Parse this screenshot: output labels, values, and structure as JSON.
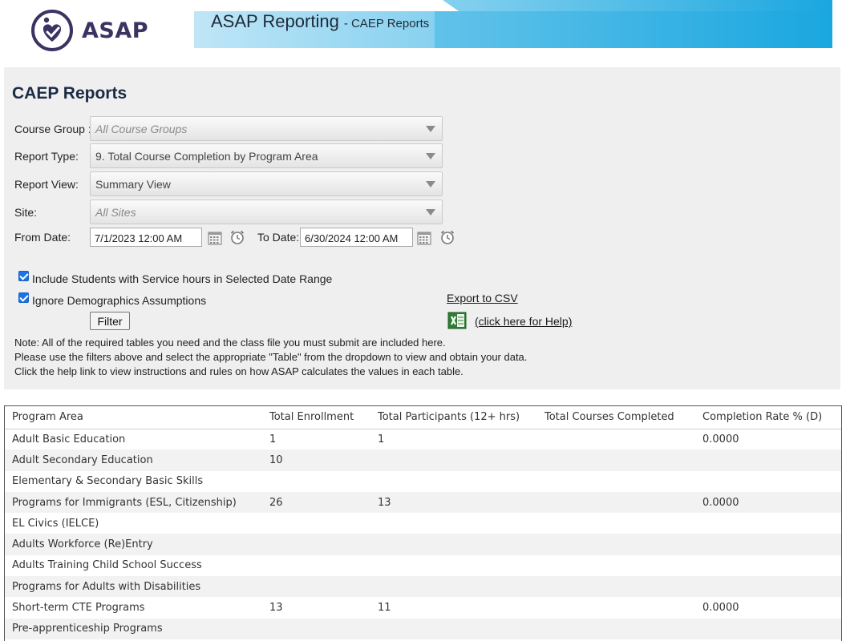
{
  "header": {
    "logo_text": "ASAP",
    "banner_title": "ASAP Reporting",
    "banner_subtitle": "- CAEP Reports",
    "colors": {
      "banner": "#1aa7df",
      "logo": "#3a3463"
    }
  },
  "filters": {
    "title": "CAEP Reports",
    "course_group": {
      "label": "Course Group :",
      "value": "All Course Groups"
    },
    "report_type": {
      "label": "Report Type:",
      "value": "9. Total Course Completion by Program Area"
    },
    "report_view": {
      "label": "Report View:",
      "value": "Summary View"
    },
    "site": {
      "label": "Site:",
      "value": "All Sites"
    },
    "from_date": {
      "label": "From Date:",
      "value": "7/1/2023 12:00 AM"
    },
    "to_date": {
      "label": "To Date:",
      "value": "6/30/2024 12:00 AM"
    },
    "include_service_hours": {
      "label": "Include Students with Service hours in Selected Date Range",
      "checked": true
    },
    "ignore_demographics": {
      "label": "Ignore Demographics Assumptions",
      "checked": true
    },
    "filter_button": "Filter",
    "export_link": "Export to CSV",
    "help_link": "(click here for Help)",
    "note_lines": [
      "Note: All of the required tables you need and the class file you must submit are included here.",
      "Please use the filters above and select the appropriate \"Table\" from the dropdown to view and obtain your data.",
      "Click the help link to view instructions and rules on how ASAP calculates the values in each table."
    ]
  },
  "table": {
    "headers": [
      "Program Area",
      "Total Enrollment",
      "Total Participants (12+ hrs)",
      "Total Courses Completed",
      "Completion Rate % (D)"
    ],
    "rows": [
      [
        "Adult Basic Education",
        "1",
        "1",
        "",
        "0.0000"
      ],
      [
        "Adult Secondary Education",
        "10",
        "",
        "",
        ""
      ],
      [
        "Elementary & Secondary Basic Skills",
        "",
        "",
        "",
        ""
      ],
      [
        "Programs for Immigrants (ESL, Citizenship)",
        "26",
        "13",
        "",
        "0.0000"
      ],
      [
        "EL Civics (IELCE)",
        "",
        "",
        "",
        ""
      ],
      [
        "Adults Workforce (Re)Entry",
        "",
        "",
        "",
        ""
      ],
      [
        "Adults Training Child School Success",
        "",
        "",
        "",
        ""
      ],
      [
        "Programs for Adults with Disabilities",
        "",
        "",
        "",
        ""
      ],
      [
        "Short-term CTE Programs",
        "13",
        "11",
        "",
        "0.0000"
      ],
      [
        "Pre-apprenticeship Programs",
        "",
        "",
        "",
        ""
      ]
    ]
  }
}
